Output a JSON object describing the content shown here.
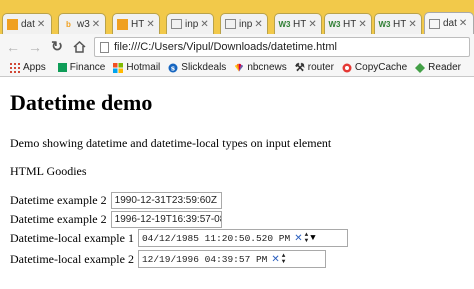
{
  "tabs": [
    {
      "label": "dat",
      "icon": "document-icon",
      "color": "#f0a020"
    },
    {
      "label": "w3",
      "icon": "bing-icon",
      "color": "#f0a020"
    },
    {
      "label": "HT",
      "icon": "document-icon",
      "color": "#f0a020"
    },
    {
      "label": "inp",
      "icon": "document-icon",
      "color": "#888888"
    },
    {
      "label": "inp",
      "icon": "document-icon",
      "color": "#888888"
    },
    {
      "label": "HT",
      "icon": "w3schools-icon",
      "color": "#2e7d32"
    },
    {
      "label": "HT",
      "icon": "w3schools-icon",
      "color": "#2e7d32"
    },
    {
      "label": "HT",
      "icon": "w3schools-icon",
      "color": "#2e7d32"
    },
    {
      "label": "dat",
      "icon": "document-icon",
      "color": "#888888"
    }
  ],
  "toolbar": {
    "url": "file:///C:/Users/Vipul/Downloads/datetime.html"
  },
  "bookmarks": [
    {
      "label": "Apps",
      "icon": "apps-icon",
      "color": "#d14836"
    },
    {
      "label": "Finance",
      "icon": "finance-icon",
      "color": "#0f9d58"
    },
    {
      "label": "Hotmail",
      "icon": "hotmail-icon",
      "color": "#d04b1f"
    },
    {
      "label": "Slickdeals",
      "icon": "slickdeals-icon",
      "color": "#1565c0"
    },
    {
      "label": "nbcnews",
      "icon": "nbc-peacock-icon",
      "color": "#7b1fa2"
    },
    {
      "label": "router",
      "icon": "tools-icon",
      "color": "#333333"
    },
    {
      "label": "CopyCache",
      "icon": "copycache-icon",
      "color": "#e53935"
    },
    {
      "label": "Reader",
      "icon": "reader-icon",
      "color": "#43a047"
    }
  ],
  "page": {
    "heading": "Datetime demo",
    "description": "Demo showing datetime and datetime-local types on input element",
    "brand": "HTML Goodies",
    "rows": [
      {
        "label": "Datetime example 2",
        "value": "1990-12-31T23:59:60Z"
      },
      {
        "label": "Datetime example 2",
        "value": "1996-12-19T16:39:57-08:0"
      },
      {
        "label": "Datetime-local example 1",
        "value": "04/12/1985 11:20:50.520 PM"
      },
      {
        "label": "Datetime-local example 2",
        "value": "12/19/1996 04:39:57 PM"
      }
    ]
  }
}
